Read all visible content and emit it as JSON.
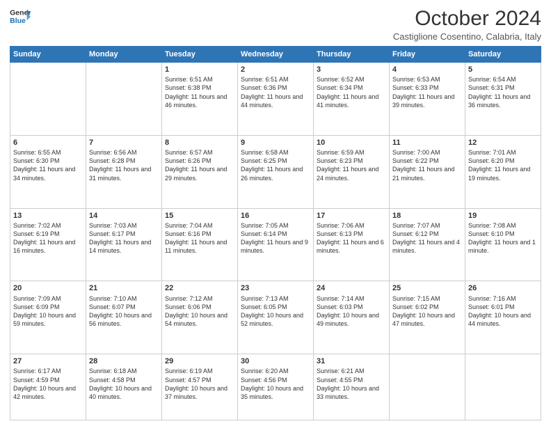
{
  "header": {
    "logo_line1": "General",
    "logo_line2": "Blue",
    "month_year": "October 2024",
    "location": "Castiglione Cosentino, Calabria, Italy"
  },
  "days_of_week": [
    "Sunday",
    "Monday",
    "Tuesday",
    "Wednesday",
    "Thursday",
    "Friday",
    "Saturday"
  ],
  "weeks": [
    [
      {
        "day": "",
        "info": ""
      },
      {
        "day": "",
        "info": ""
      },
      {
        "day": "1",
        "info": "Sunrise: 6:51 AM\nSunset: 6:38 PM\nDaylight: 11 hours and 46 minutes."
      },
      {
        "day": "2",
        "info": "Sunrise: 6:51 AM\nSunset: 6:36 PM\nDaylight: 11 hours and 44 minutes."
      },
      {
        "day": "3",
        "info": "Sunrise: 6:52 AM\nSunset: 6:34 PM\nDaylight: 11 hours and 41 minutes."
      },
      {
        "day": "4",
        "info": "Sunrise: 6:53 AM\nSunset: 6:33 PM\nDaylight: 11 hours and 39 minutes."
      },
      {
        "day": "5",
        "info": "Sunrise: 6:54 AM\nSunset: 6:31 PM\nDaylight: 11 hours and 36 minutes."
      }
    ],
    [
      {
        "day": "6",
        "info": "Sunrise: 6:55 AM\nSunset: 6:30 PM\nDaylight: 11 hours and 34 minutes."
      },
      {
        "day": "7",
        "info": "Sunrise: 6:56 AM\nSunset: 6:28 PM\nDaylight: 11 hours and 31 minutes."
      },
      {
        "day": "8",
        "info": "Sunrise: 6:57 AM\nSunset: 6:26 PM\nDaylight: 11 hours and 29 minutes."
      },
      {
        "day": "9",
        "info": "Sunrise: 6:58 AM\nSunset: 6:25 PM\nDaylight: 11 hours and 26 minutes."
      },
      {
        "day": "10",
        "info": "Sunrise: 6:59 AM\nSunset: 6:23 PM\nDaylight: 11 hours and 24 minutes."
      },
      {
        "day": "11",
        "info": "Sunrise: 7:00 AM\nSunset: 6:22 PM\nDaylight: 11 hours and 21 minutes."
      },
      {
        "day": "12",
        "info": "Sunrise: 7:01 AM\nSunset: 6:20 PM\nDaylight: 11 hours and 19 minutes."
      }
    ],
    [
      {
        "day": "13",
        "info": "Sunrise: 7:02 AM\nSunset: 6:19 PM\nDaylight: 11 hours and 16 minutes."
      },
      {
        "day": "14",
        "info": "Sunrise: 7:03 AM\nSunset: 6:17 PM\nDaylight: 11 hours and 14 minutes."
      },
      {
        "day": "15",
        "info": "Sunrise: 7:04 AM\nSunset: 6:16 PM\nDaylight: 11 hours and 11 minutes."
      },
      {
        "day": "16",
        "info": "Sunrise: 7:05 AM\nSunset: 6:14 PM\nDaylight: 11 hours and 9 minutes."
      },
      {
        "day": "17",
        "info": "Sunrise: 7:06 AM\nSunset: 6:13 PM\nDaylight: 11 hours and 6 minutes."
      },
      {
        "day": "18",
        "info": "Sunrise: 7:07 AM\nSunset: 6:12 PM\nDaylight: 11 hours and 4 minutes."
      },
      {
        "day": "19",
        "info": "Sunrise: 7:08 AM\nSunset: 6:10 PM\nDaylight: 11 hours and 1 minute."
      }
    ],
    [
      {
        "day": "20",
        "info": "Sunrise: 7:09 AM\nSunset: 6:09 PM\nDaylight: 10 hours and 59 minutes."
      },
      {
        "day": "21",
        "info": "Sunrise: 7:10 AM\nSunset: 6:07 PM\nDaylight: 10 hours and 56 minutes."
      },
      {
        "day": "22",
        "info": "Sunrise: 7:12 AM\nSunset: 6:06 PM\nDaylight: 10 hours and 54 minutes."
      },
      {
        "day": "23",
        "info": "Sunrise: 7:13 AM\nSunset: 6:05 PM\nDaylight: 10 hours and 52 minutes."
      },
      {
        "day": "24",
        "info": "Sunrise: 7:14 AM\nSunset: 6:03 PM\nDaylight: 10 hours and 49 minutes."
      },
      {
        "day": "25",
        "info": "Sunrise: 7:15 AM\nSunset: 6:02 PM\nDaylight: 10 hours and 47 minutes."
      },
      {
        "day": "26",
        "info": "Sunrise: 7:16 AM\nSunset: 6:01 PM\nDaylight: 10 hours and 44 minutes."
      }
    ],
    [
      {
        "day": "27",
        "info": "Sunrise: 6:17 AM\nSunset: 4:59 PM\nDaylight: 10 hours and 42 minutes."
      },
      {
        "day": "28",
        "info": "Sunrise: 6:18 AM\nSunset: 4:58 PM\nDaylight: 10 hours and 40 minutes."
      },
      {
        "day": "29",
        "info": "Sunrise: 6:19 AM\nSunset: 4:57 PM\nDaylight: 10 hours and 37 minutes."
      },
      {
        "day": "30",
        "info": "Sunrise: 6:20 AM\nSunset: 4:56 PM\nDaylight: 10 hours and 35 minutes."
      },
      {
        "day": "31",
        "info": "Sunrise: 6:21 AM\nSunset: 4:55 PM\nDaylight: 10 hours and 33 minutes."
      },
      {
        "day": "",
        "info": ""
      },
      {
        "day": "",
        "info": ""
      }
    ]
  ]
}
